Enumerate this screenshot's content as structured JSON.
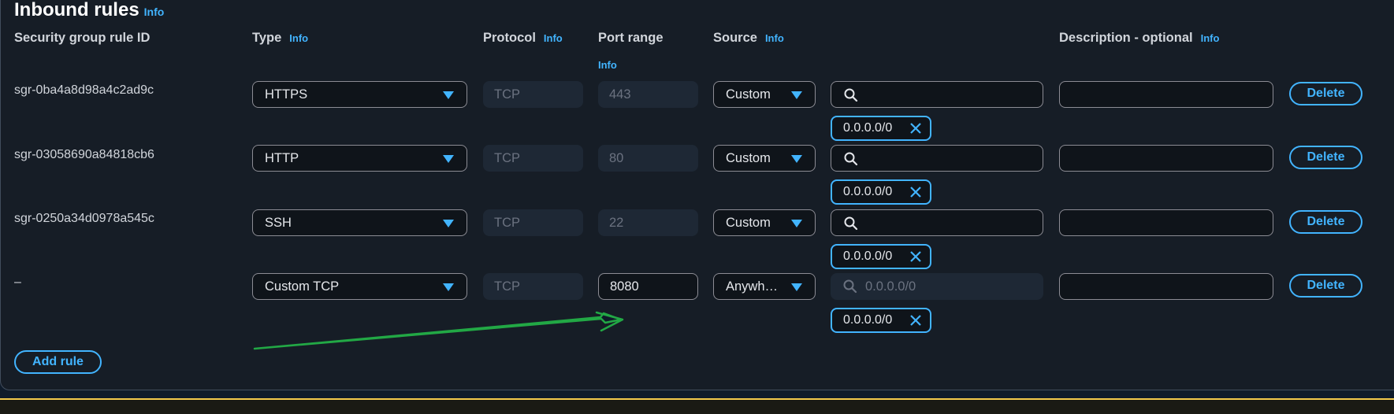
{
  "section": {
    "title": "Inbound rules",
    "info": "Info"
  },
  "columns": {
    "rule_id": "Security group rule ID",
    "type": "Type",
    "type_info": "Info",
    "protocol": "Protocol",
    "protocol_info": "Info",
    "port_range": "Port range",
    "port_range_info": "Info",
    "source": "Source",
    "source_info": "Info",
    "description": "Description - optional",
    "description_info": "Info"
  },
  "rules": [
    {
      "id": "sgr-0ba4a8d98a4c2ad9c",
      "type": "HTTPS",
      "protocol": "TCP",
      "port": "443",
      "source": "Custom",
      "search_placeholder": "",
      "token": "0.0.0.0/0",
      "description": "",
      "delete": "Delete"
    },
    {
      "id": "sgr-03058690a84818cb6",
      "type": "HTTP",
      "protocol": "TCP",
      "port": "80",
      "source": "Custom",
      "search_placeholder": "",
      "token": "0.0.0.0/0",
      "description": "",
      "delete": "Delete"
    },
    {
      "id": "sgr-0250a34d0978a545c",
      "type": "SSH",
      "protocol": "TCP",
      "port": "22",
      "source": "Custom",
      "search_placeholder": "",
      "token": "0.0.0.0/0",
      "description": "",
      "delete": "Delete"
    },
    {
      "id": "–",
      "type": "Custom TCP",
      "protocol": "TCP",
      "port": "8080",
      "source": "Anywh…",
      "search_placeholder": "0.0.0.0/0",
      "token": "0.0.0.0/0",
      "description": "",
      "delete": "Delete"
    }
  ],
  "add_rule": "Add rule",
  "colors": {
    "accent": "#42b4ff",
    "annotation_arrow": "#22a845",
    "warning_border": "#f2c94c"
  }
}
